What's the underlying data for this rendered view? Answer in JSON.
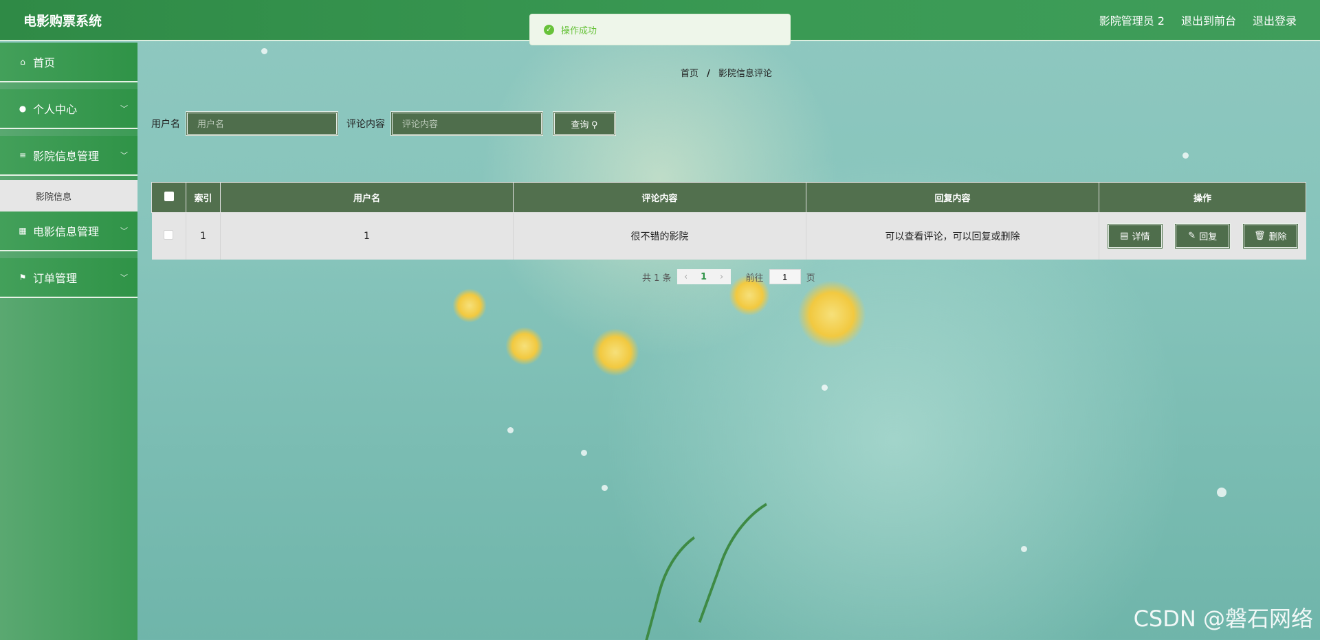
{
  "app": {
    "title": "电影购票系统"
  },
  "header": {
    "user": "影院管理员 2",
    "front_link": "退出到前台",
    "logout": "退出登录"
  },
  "toast": {
    "message": "操作成功",
    "icon": "check-circle-icon",
    "color": "#67c23a"
  },
  "sidebar": {
    "items": [
      {
        "label": "首页",
        "icon": "home-icon"
      },
      {
        "label": "个人中心",
        "icon": "user-icon"
      },
      {
        "label": "影院信息管理",
        "icon": "sliders-icon",
        "expanded": true,
        "children": [
          {
            "label": "影院信息"
          }
        ]
      },
      {
        "label": "电影信息管理",
        "icon": "grid-icon"
      },
      {
        "label": "订单管理",
        "icon": "flag-icon"
      }
    ]
  },
  "breadcrumb": {
    "home": "首页",
    "separator": "/",
    "current": "影院信息评论"
  },
  "search": {
    "username_label": "用户名",
    "username_placeholder": "用户名",
    "content_label": "评论内容",
    "content_placeholder": "评论内容",
    "button": "查询"
  },
  "table": {
    "headers": [
      "索引",
      "用户名",
      "评论内容",
      "回复内容",
      "操作"
    ],
    "rows": [
      {
        "index": "1",
        "username": "1",
        "content": "很不错的影院",
        "reply": "可以查看评论，可以回复或删除"
      }
    ],
    "actions": {
      "detail": "详情",
      "reply": "回复",
      "delete": "删除"
    }
  },
  "pagination": {
    "total_text": "共 1 条",
    "current_page": "1",
    "goto_label": "前往",
    "goto_value": "1",
    "page_suffix": "页"
  },
  "watermark": "CSDN @磐石网络",
  "colors": {
    "primary_green": "#3a9a54",
    "button_dark": "#4f6e4c",
    "table_header": "#52704e"
  }
}
